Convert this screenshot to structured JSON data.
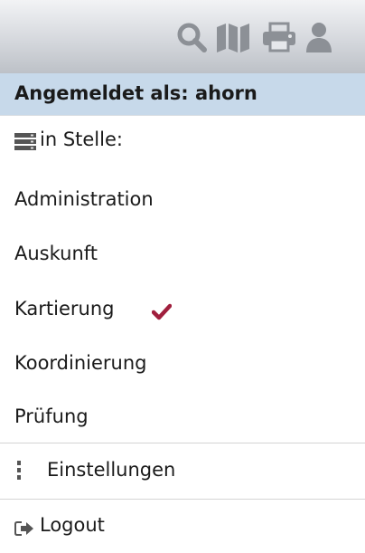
{
  "toolbar": {
    "icons": [
      "search-icon",
      "map-icon",
      "print-icon",
      "user-icon"
    ],
    "icon_color": "#8c9096"
  },
  "header": {
    "logged_in_label": "Angemeldet als: ahorn",
    "background": "#c7d9ea"
  },
  "stellen": {
    "heading_label": "in Stelle:",
    "heading_icon": "server-icon",
    "items": [
      {
        "label": "Administration"
      },
      {
        "label": "Auskunft"
      },
      {
        "label": "Kartierung",
        "selected": true
      },
      {
        "label": "Koordinierung"
      },
      {
        "label": "Prüfung"
      }
    ],
    "selected_mark": "checkmark-icon",
    "selected_mark_color": "#a01f3d"
  },
  "settings": {
    "label": "Einstellungen",
    "icon": "vertical-ellipsis-icon"
  },
  "logout": {
    "label": "Logout",
    "icon": "logout-icon"
  }
}
